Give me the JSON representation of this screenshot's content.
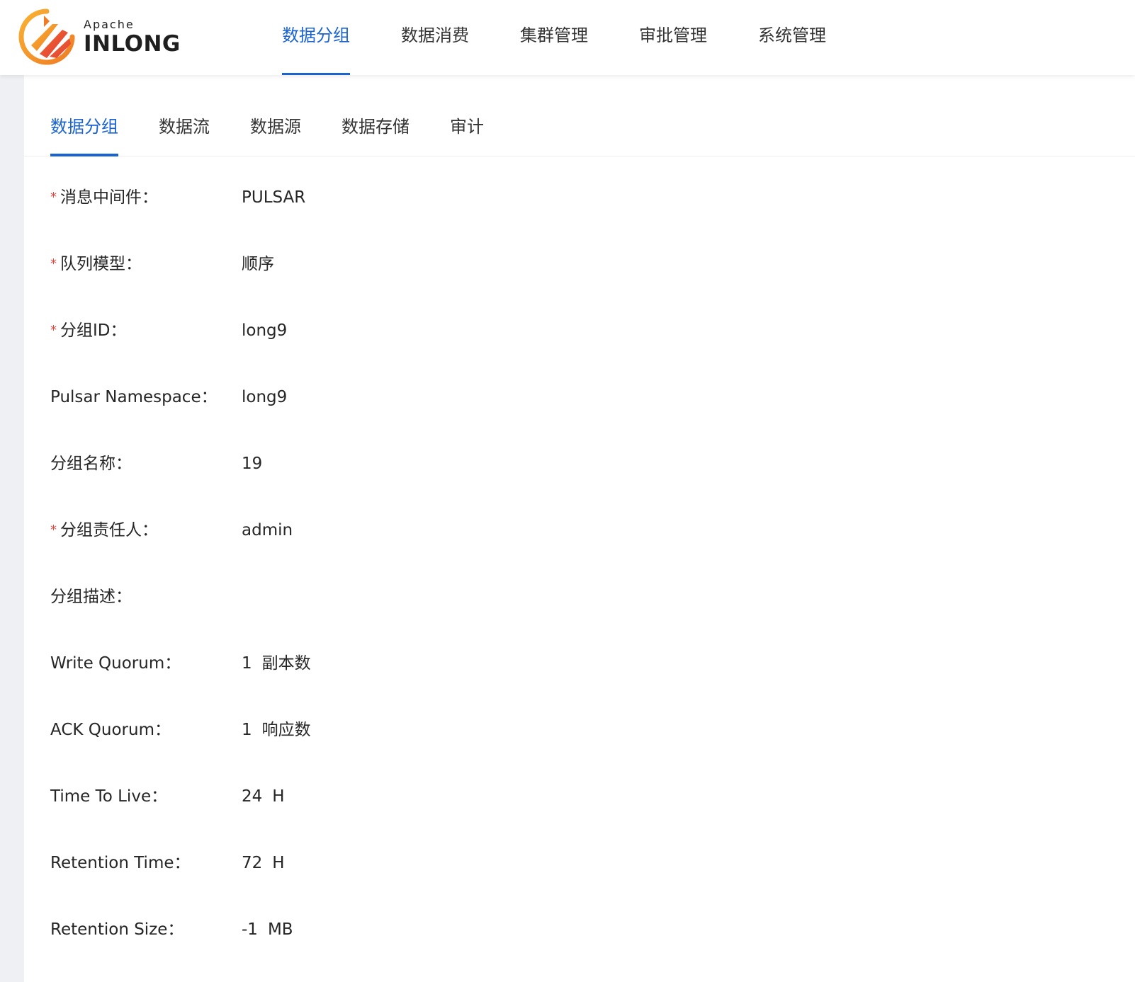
{
  "brand": {
    "apache": "Apache",
    "product": "INLONG",
    "colors": {
      "orange": "#f7a21b",
      "red": "#e8453c"
    }
  },
  "top_nav": {
    "items": [
      {
        "label": "数据分组",
        "active": true
      },
      {
        "label": "数据消费",
        "active": false
      },
      {
        "label": "集群管理",
        "active": false
      },
      {
        "label": "审批管理",
        "active": false
      },
      {
        "label": "系统管理",
        "active": false
      }
    ]
  },
  "sub_tabs": {
    "items": [
      {
        "label": "数据分组",
        "active": true
      },
      {
        "label": "数据流",
        "active": false
      },
      {
        "label": "数据源",
        "active": false
      },
      {
        "label": "数据存储",
        "active": false
      },
      {
        "label": "审计",
        "active": false
      }
    ]
  },
  "form": {
    "required_mark": "*",
    "rows": [
      {
        "label": "消息中间件：",
        "value": "PULSAR",
        "unit": "",
        "required": true
      },
      {
        "label": "队列模型：",
        "value": "顺序",
        "unit": "",
        "required": true
      },
      {
        "label": "分组ID：",
        "value": "long9",
        "unit": "",
        "required": true
      },
      {
        "label": "Pulsar Namespace：",
        "value": "long9",
        "unit": "",
        "required": false
      },
      {
        "label": "分组名称：",
        "value": "19",
        "unit": "",
        "required": false
      },
      {
        "label": "分组责任人：",
        "value": "admin",
        "unit": "",
        "required": true
      },
      {
        "label": "分组描述：",
        "value": "",
        "unit": "",
        "required": false
      },
      {
        "label": "Write Quorum：",
        "value": "1",
        "unit": "副本数",
        "required": false
      },
      {
        "label": "ACK Quorum：",
        "value": "1",
        "unit": "响应数",
        "required": false
      },
      {
        "label": "Time To Live：",
        "value": "24",
        "unit": "H",
        "required": false
      },
      {
        "label": "Retention Time：",
        "value": "72",
        "unit": "H",
        "required": false
      },
      {
        "label": "Retention Size：",
        "value": "-1",
        "unit": "MB",
        "required": false
      }
    ]
  },
  "theme": {
    "accent": "#1a63d1",
    "required": "#e8453c",
    "side_strip": "#eef0f4"
  }
}
